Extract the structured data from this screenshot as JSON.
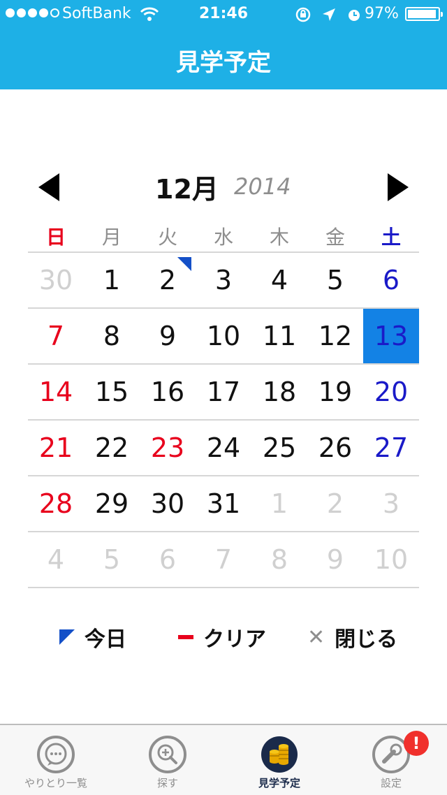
{
  "status": {
    "carrier": "SoftBank",
    "time": "21:46",
    "battery": "97%",
    "battery_level": 0.97
  },
  "nav": {
    "title": "見学予定"
  },
  "calendar": {
    "month": "12月",
    "year": "2014",
    "weekdays": [
      "日",
      "月",
      "火",
      "水",
      "木",
      "金",
      "土"
    ],
    "weeks": [
      [
        {
          "d": "30",
          "k": "other"
        },
        {
          "d": "1"
        },
        {
          "d": "2",
          "today": true
        },
        {
          "d": "3"
        },
        {
          "d": "4"
        },
        {
          "d": "5"
        },
        {
          "d": "6",
          "k": "sat"
        }
      ],
      [
        {
          "d": "7",
          "k": "sun"
        },
        {
          "d": "8"
        },
        {
          "d": "9"
        },
        {
          "d": "10"
        },
        {
          "d": "11"
        },
        {
          "d": "12"
        },
        {
          "d": "13",
          "k": "sat",
          "selected": true
        }
      ],
      [
        {
          "d": "14",
          "k": "sun"
        },
        {
          "d": "15"
        },
        {
          "d": "16"
        },
        {
          "d": "17"
        },
        {
          "d": "18"
        },
        {
          "d": "19"
        },
        {
          "d": "20",
          "k": "sat"
        }
      ],
      [
        {
          "d": "21",
          "k": "sun"
        },
        {
          "d": "22"
        },
        {
          "d": "23",
          "k": "hol"
        },
        {
          "d": "24"
        },
        {
          "d": "25"
        },
        {
          "d": "26"
        },
        {
          "d": "27",
          "k": "sat"
        }
      ],
      [
        {
          "d": "28",
          "k": "sun"
        },
        {
          "d": "29"
        },
        {
          "d": "30"
        },
        {
          "d": "31"
        },
        {
          "d": "1",
          "k": "other"
        },
        {
          "d": "2",
          "k": "other"
        },
        {
          "d": "3",
          "k": "other"
        }
      ],
      [
        {
          "d": "4",
          "k": "other"
        },
        {
          "d": "5",
          "k": "other"
        },
        {
          "d": "6",
          "k": "other"
        },
        {
          "d": "7",
          "k": "other"
        },
        {
          "d": "8",
          "k": "other"
        },
        {
          "d": "9",
          "k": "other"
        },
        {
          "d": "10",
          "k": "other"
        }
      ]
    ]
  },
  "actions": {
    "today": "今日",
    "clear": "クリア",
    "close": "閉じる"
  },
  "tabs": [
    {
      "label": "やりとり一覧",
      "icon": "chat-bubble-icon"
    },
    {
      "label": "探す",
      "icon": "search-icon"
    },
    {
      "label": "見学予定",
      "icon": "coins-icon",
      "active": true
    },
    {
      "label": "設定",
      "icon": "wrench-icon",
      "badge": "!"
    }
  ],
  "colors": {
    "header": "#1EB0E6",
    "sunday": "#E8001C",
    "saturday": "#1A1AC8",
    "selected": "#1382E5",
    "today_marker": "#1450C8",
    "badge": "#F0302C"
  }
}
